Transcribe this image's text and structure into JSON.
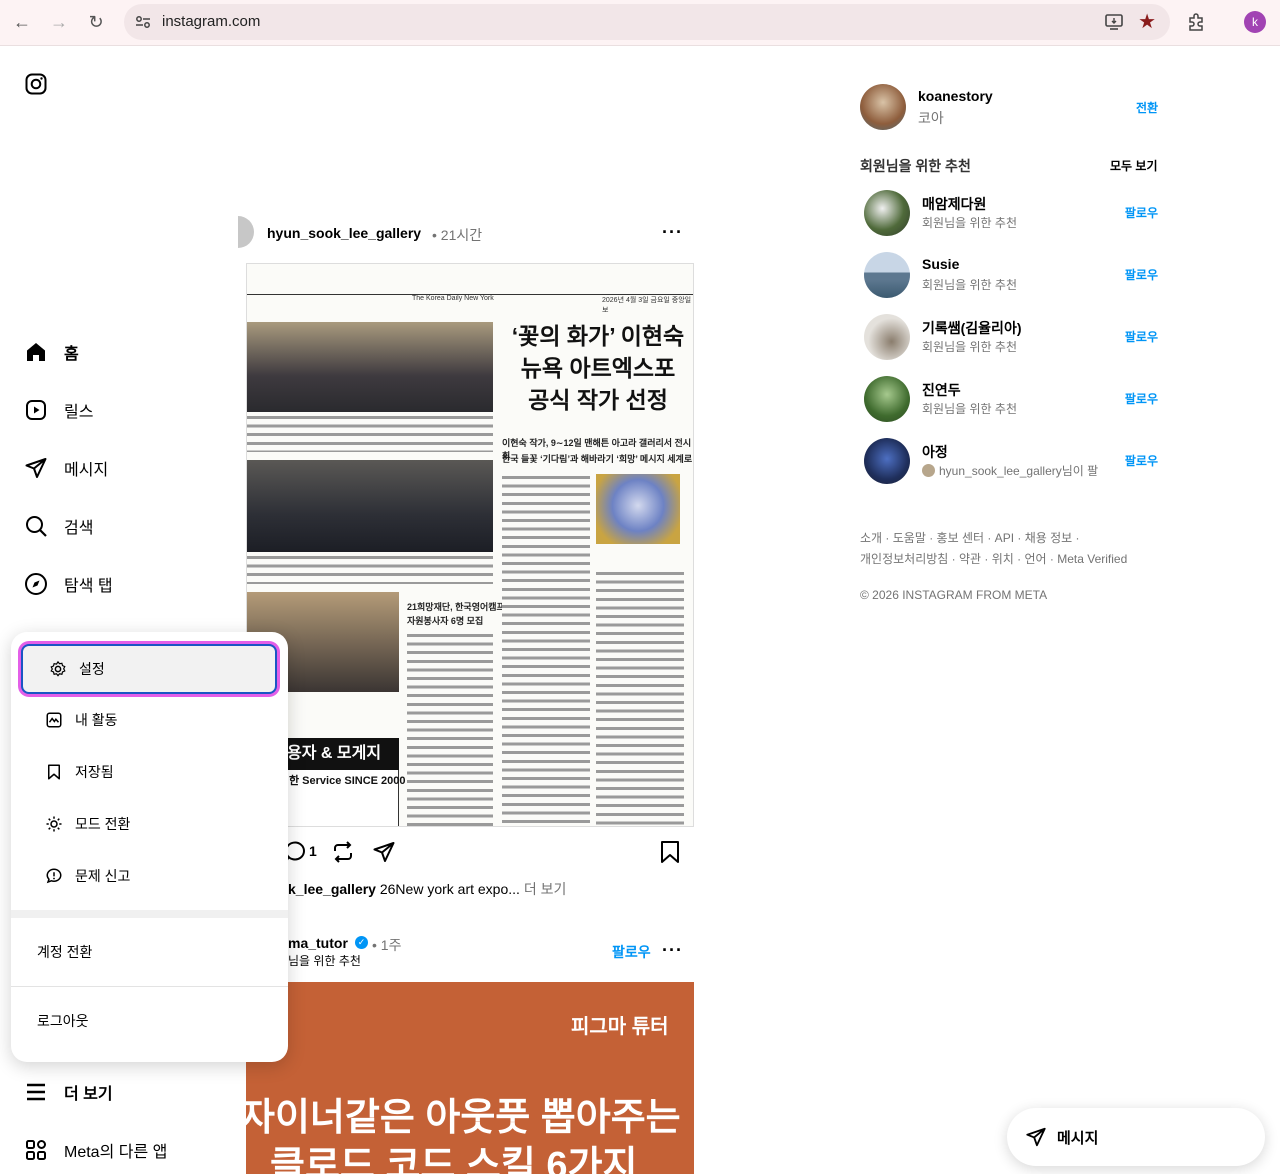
{
  "browser": {
    "url": "instagram.com",
    "profile_initial": "k"
  },
  "nav": {
    "home": "홈",
    "reels": "릴스",
    "messages": "메시지",
    "search": "검색",
    "explore": "탐색 탭",
    "more": "더 보기",
    "meta": "Meta의 다른 앱"
  },
  "popup": {
    "settings": "설정",
    "activity": "내 활동",
    "saved": "저장됨",
    "mode": "모드 전환",
    "report": "문제 신고",
    "switch_account": "계정 전환",
    "logout": "로그아웃"
  },
  "post1": {
    "username": "hyun_sook_lee_gallery",
    "time": "• 21시간",
    "comment_count": "1",
    "caption_user": "k_lee_gallery",
    "caption_text": "26New york art expo...",
    "caption_more": "더 보기",
    "newspaper": {
      "masthead": "The Korea Daily New York",
      "date": "2026년 4월 3일 금요일 중앙일보",
      "headline_1": "‘꽃의 화가’ 이현숙",
      "headline_2": "뉴욕 아트엑스포",
      "headline_3": "공식 작가 선정",
      "sub_1": "이현숙 작가, 9∼12일 맨해튼 아고라 갤러리서 전시회",
      "sub_2": "한국 들꽃 ‘기다림’과 해바라기 ‘희망’ 메시지 세계로",
      "box_title_1": "21희망재단, 한국영어캠프",
      "box_title_2": "자원봉사자 6명 모집",
      "ad_1": "용자 & 모게지",
      "ad_2": "한 Service SINCE 2000"
    }
  },
  "post2": {
    "username": "ma_tutor",
    "time": "• 1주",
    "subtitle": "님을 위한 추천",
    "follow": "팔로우",
    "brand": "피그마 튜터",
    "title_1": "자이너같은 아웃풋 뽑아주는",
    "title_2": "클로드 코드 스킬 6가지"
  },
  "sidebar": {
    "me_username": "koanestory",
    "me_name": "코아",
    "switch": "전환",
    "suggestions_title": "회원님을 위한 추천",
    "see_all": "모두 보기",
    "suggestions": [
      {
        "name": "매암제다원",
        "sub": "회원님을 위한 추천",
        "action": "팔로우"
      },
      {
        "name": "Susie",
        "sub": "회원님을 위한 추천",
        "action": "팔로우"
      },
      {
        "name": "기록쌤(김율리아)",
        "sub": "회원님을 위한 추천",
        "action": "팔로우"
      },
      {
        "name": "진연두",
        "sub": "회원님을 위한 추천",
        "action": "팔로우"
      },
      {
        "name": "아정",
        "sub": "hyun_sook_lee_gallery님이 팔",
        "action": "팔로우"
      }
    ],
    "footer_1": "소개 · 도움말 · 홍보 센터 · API · 채용 정보 ·",
    "footer_2": "개인정보처리방침 · 약관 · 위치 · 언어 · Meta Verified",
    "copyright": "© 2026 INSTAGRAM FROM META"
  },
  "message_pill": "메시지",
  "colors": {
    "accent": "#0095f6",
    "focus_ring": "#1a56c4",
    "highlight": "#e35fe8"
  }
}
